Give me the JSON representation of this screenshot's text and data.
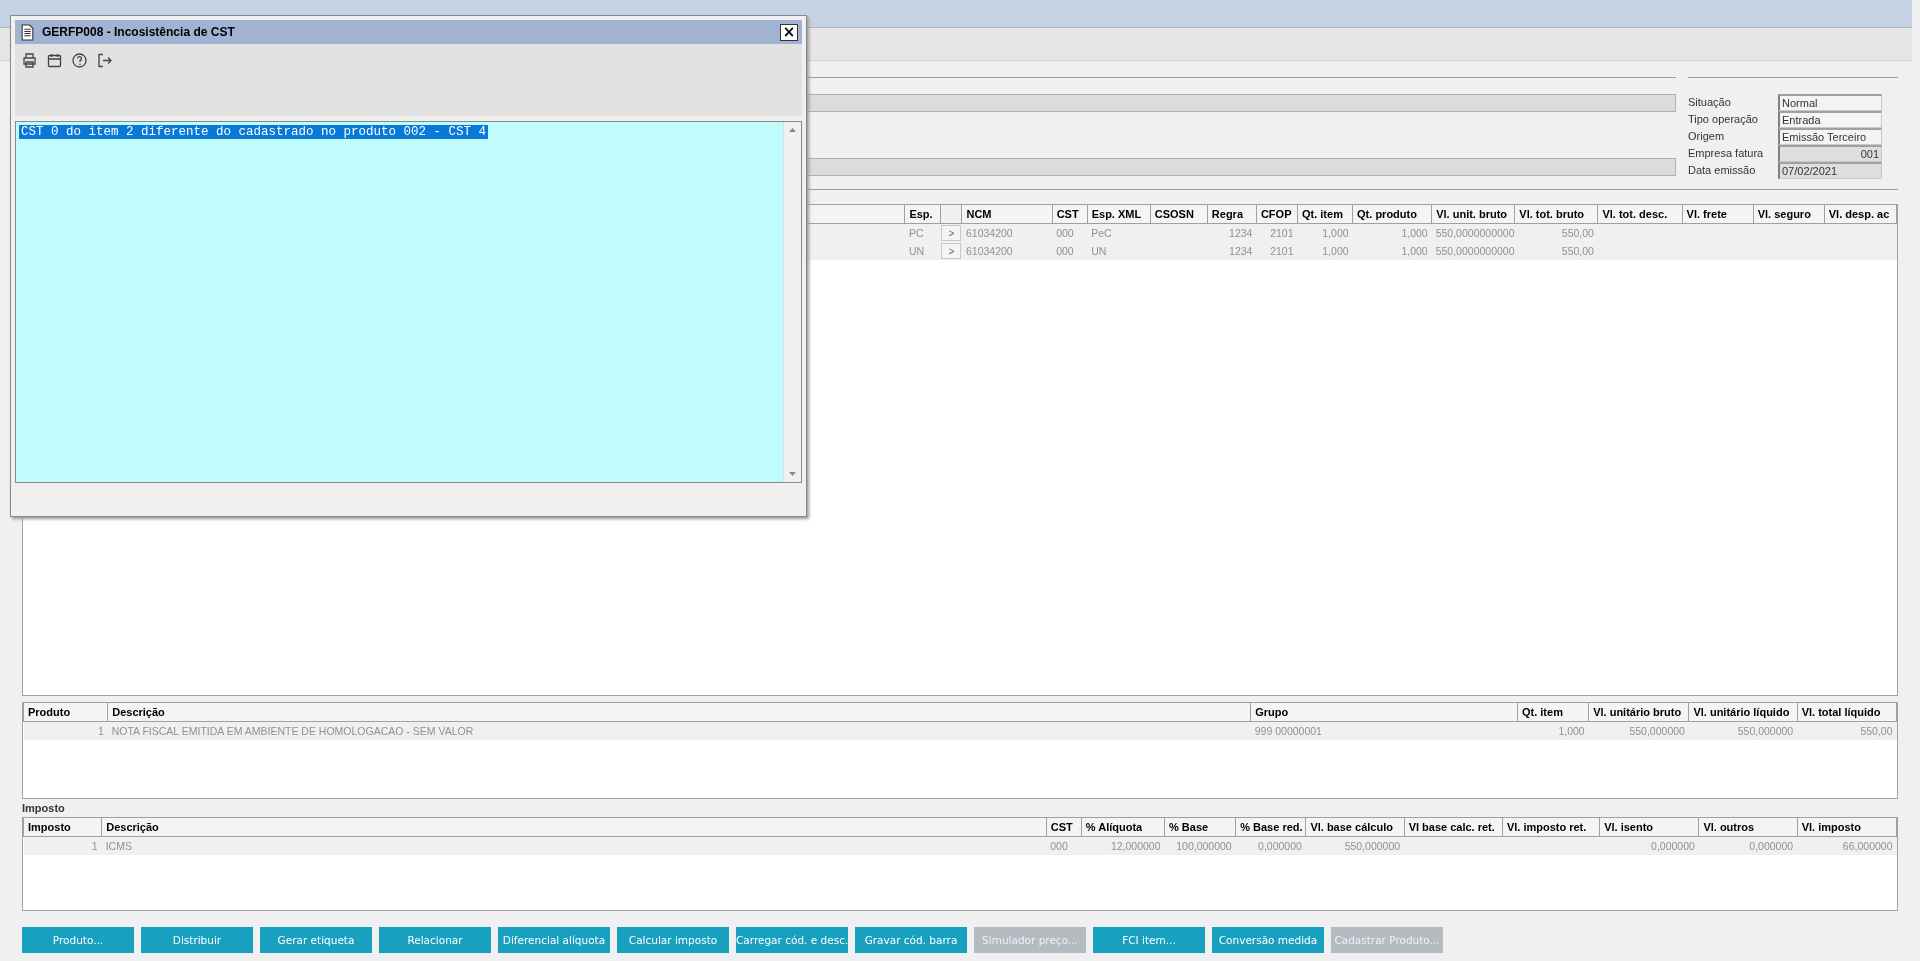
{
  "main_window": {
    "info_panel": {
      "fields": [
        {
          "label": "Situação",
          "value": "Normal",
          "readonly": false,
          "kind": "text"
        },
        {
          "label": "Tipo operação",
          "value": "Entrada",
          "readonly": false,
          "kind": "text"
        },
        {
          "label": "Origem",
          "value": "Emissão Terceiro",
          "readonly": false,
          "kind": "text"
        },
        {
          "label": "Empresa fatura",
          "value": "001",
          "readonly": true,
          "kind": "number"
        },
        {
          "label": "Data emissão",
          "value": "07/02/2021",
          "readonly": true,
          "kind": "text"
        }
      ]
    }
  },
  "items_grid": {
    "columns": [
      {
        "label": "Esp.",
        "kind": "text"
      },
      {
        "kind": "button"
      },
      {
        "label": "NCM",
        "kind": "text"
      },
      {
        "label": "CST",
        "kind": "text"
      },
      {
        "label": "Esp. XML",
        "kind": "text"
      },
      {
        "label": "CSOSN",
        "kind": "text"
      },
      {
        "label": "Regra",
        "kind": "number"
      },
      {
        "label": "CFOP",
        "kind": "number"
      },
      {
        "label": "Qt. item",
        "kind": "number"
      },
      {
        "label": "Qt. produto",
        "kind": "number"
      },
      {
        "label": "Vl. unit. bruto",
        "kind": "number"
      },
      {
        "label": "Vl. tot. bruto",
        "kind": "number"
      },
      {
        "label": "Vl. tot. desc.",
        "kind": "number"
      },
      {
        "label": "Vl. frete",
        "kind": "number"
      },
      {
        "label": "Vl. seguro",
        "kind": "number"
      },
      {
        "label": "Vl. desp. ac",
        "kind": "number"
      }
    ],
    "rows": [
      {
        "cells": [
          "PC",
          ">",
          "61034200",
          "000",
          "PeC",
          null,
          "1234",
          "2101",
          "1,000",
          "1,000",
          "550,0000000000",
          "550,00",
          null,
          null,
          null,
          null
        ]
      },
      {
        "cells": [
          "UN",
          ">",
          "61034200",
          "000",
          "UN",
          null,
          "1234",
          "2101",
          "1,000",
          "1,000",
          "550,0000000000",
          "550,00",
          null,
          null,
          null,
          null
        ]
      }
    ]
  },
  "products_grid": {
    "columns": [
      {
        "label": "Produto",
        "kind": "number"
      },
      {
        "label": "Descrição",
        "kind": "text"
      },
      {
        "label": "Grupo",
        "kind": "text"
      },
      {
        "label": "Qt. item",
        "kind": "number"
      },
      {
        "label": "Vl. unitário bruto",
        "kind": "number"
      },
      {
        "label": "Vl. unitário líquido",
        "kind": "number"
      },
      {
        "label": "Vl. total líquido",
        "kind": "number"
      }
    ],
    "rows": [
      {
        "cells": [
          "1",
          "NOTA FISCAL EMITIDA EM AMBIENTE DE HOMOLOGACAO - SEM VALOR",
          "999 00000001",
          "1,000",
          "550,000000",
          "550,000000",
          "550,00"
        ]
      }
    ]
  },
  "tax_section": {
    "title": "Imposto",
    "columns": [
      {
        "label": "Imposto",
        "kind": "number"
      },
      {
        "label": "Descrição",
        "kind": "text"
      },
      {
        "label": "CST",
        "kind": "text"
      },
      {
        "label": "% Alíquota",
        "kind": "number"
      },
      {
        "label": "% Base",
        "kind": "number"
      },
      {
        "label": "% Base red.",
        "kind": "number"
      },
      {
        "label": "Vl. base cálculo",
        "kind": "number"
      },
      {
        "label": "Vl base calc. ret.",
        "kind": "number"
      },
      {
        "label": "Vl. imposto ret.",
        "kind": "number"
      },
      {
        "label": "Vl. isento",
        "kind": "number"
      },
      {
        "label": "Vl. outros",
        "kind": "number"
      },
      {
        "label": "Vl. imposto",
        "kind": "number"
      }
    ],
    "rows": [
      {
        "cells": [
          "1",
          "ICMS",
          "000",
          "12,000000",
          "100,000000",
          "0,000000",
          "550,000000",
          null,
          null,
          "0,000000",
          "0,000000",
          "66,000000"
        ]
      }
    ]
  },
  "buttons": [
    {
      "label": "Produto...",
      "disabled": false
    },
    {
      "label": "Distribuir",
      "disabled": false
    },
    {
      "label": "Gerar etiqueta",
      "disabled": false
    },
    {
      "label": "Relacionar",
      "disabled": false
    },
    {
      "label": "Diferencial alíquota",
      "disabled": false
    },
    {
      "label": "Calcular imposto",
      "disabled": false
    },
    {
      "label": "Carregar cód. e desc.",
      "disabled": false
    },
    {
      "label": "Gravar cód. barra",
      "disabled": false
    },
    {
      "label": "Simulador preço...",
      "disabled": true
    },
    {
      "label": "FCI item...",
      "disabled": false
    },
    {
      "label": "Conversão medida",
      "disabled": false
    },
    {
      "label": "Cadastrar Produto...",
      "disabled": true
    }
  ],
  "dialog": {
    "title": "GERFP008 - Incosistência de CST",
    "close": "×",
    "toolbar": [
      {
        "kind": "print"
      },
      {
        "kind": "calendar"
      },
      {
        "kind": "help"
      },
      {
        "kind": "exit"
      }
    ],
    "message": {
      "text": "CST 0 do item 2 diferente do cadastrado no produto 002 - CST 4",
      "selected": true
    }
  }
}
